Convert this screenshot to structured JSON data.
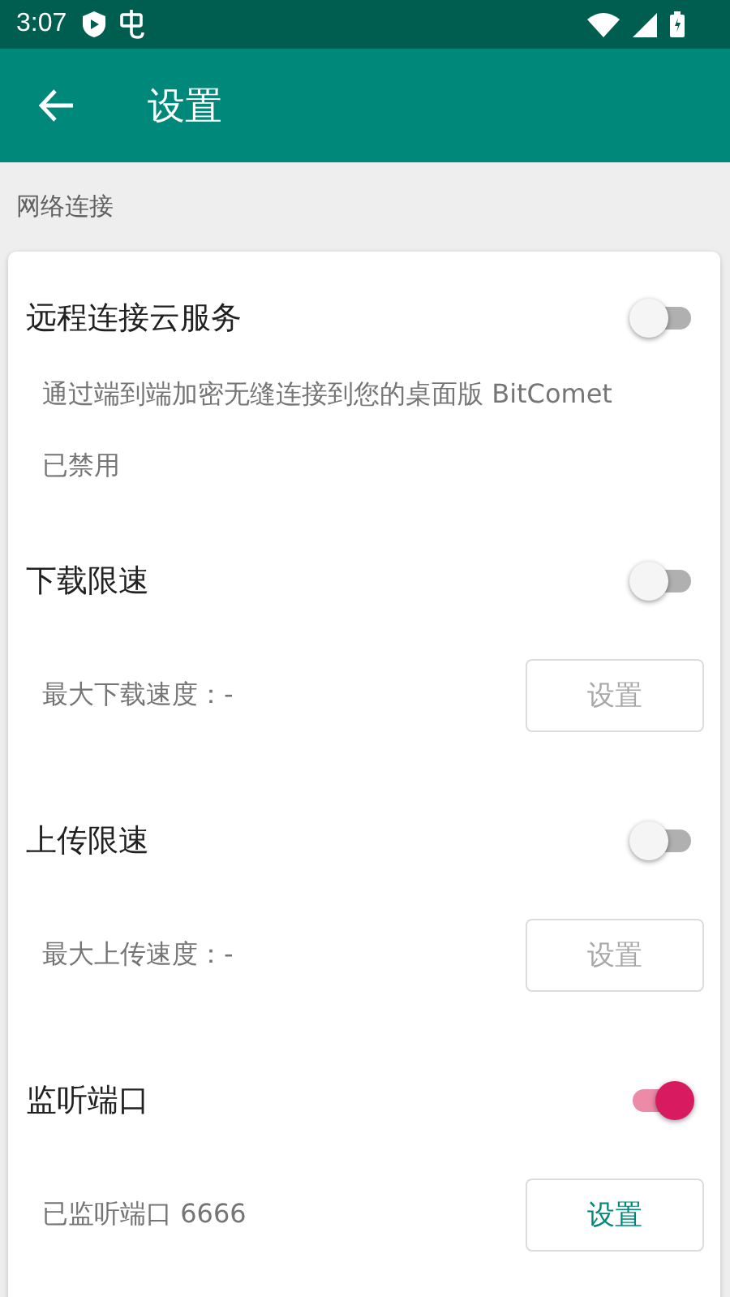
{
  "status_bar": {
    "time": "3:07"
  },
  "app_bar": {
    "title": "设置"
  },
  "section_header": "网络连接",
  "settings": [
    {
      "kind": "description",
      "title": "远程连接云服务",
      "on": false,
      "lines": [
        "通过端到端加密无缝连接到您的桌面版 BitComet",
        "已禁用"
      ]
    },
    {
      "kind": "action",
      "title": "下载限速",
      "on": false,
      "value": "最大下载速度：-",
      "button": {
        "label": "设置",
        "disabled": true
      }
    },
    {
      "kind": "action",
      "title": "上传限速",
      "on": false,
      "value": "最大上传速度：-",
      "button": {
        "label": "设置",
        "disabled": true
      }
    },
    {
      "kind": "action",
      "title": "监听端口",
      "on": true,
      "value": "已监听端口 6666",
      "button": {
        "label": "设置",
        "disabled": false
      }
    }
  ]
}
